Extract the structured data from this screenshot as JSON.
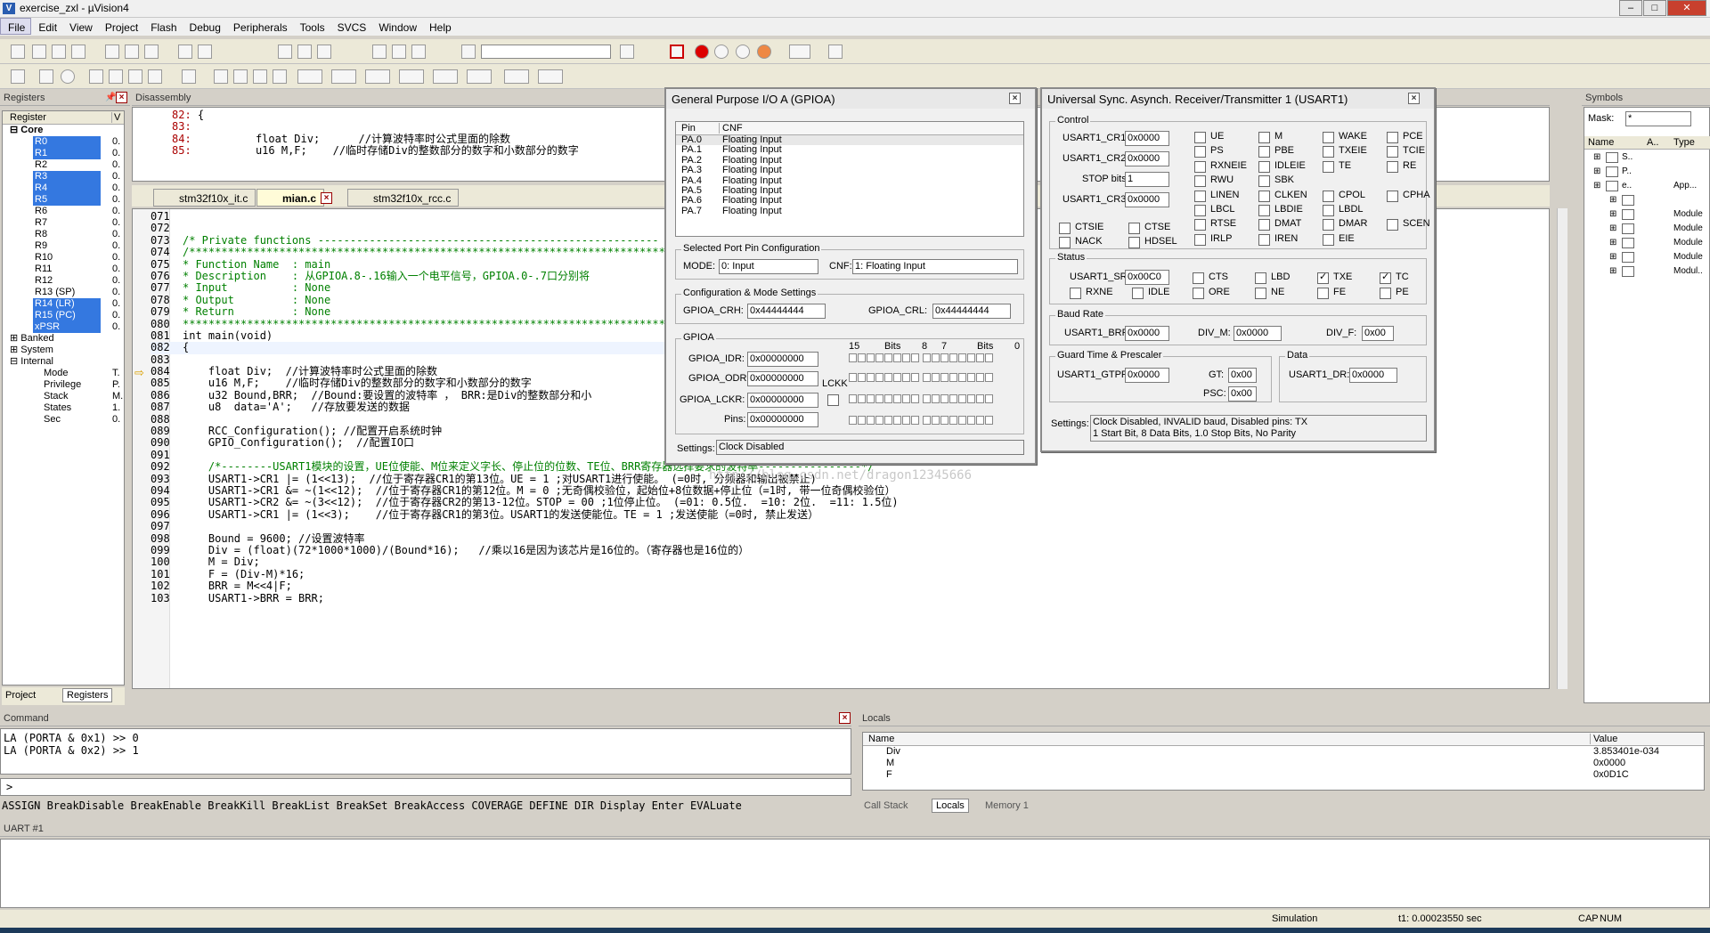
{
  "window": {
    "title": "exercise_zxl - µVision4"
  },
  "menu": [
    "File",
    "Edit",
    "View",
    "Project",
    "Flash",
    "Debug",
    "Peripherals",
    "Tools",
    "SVCS",
    "Window",
    "Help"
  ],
  "registers": {
    "title": "Registers",
    "col_register": "Register",
    "col_value": "V",
    "groups": [
      "Core",
      "Banked",
      "System",
      "Internal"
    ],
    "core": [
      {
        "n": "R0",
        "v": "0.",
        "s": true
      },
      {
        "n": "R1",
        "v": "0.",
        "s": true
      },
      {
        "n": "R2",
        "v": "0.",
        "s": false
      },
      {
        "n": "R3",
        "v": "0.",
        "s": true
      },
      {
        "n": "R4",
        "v": "0.",
        "s": true
      },
      {
        "n": "R5",
        "v": "0.",
        "s": true
      },
      {
        "n": "R6",
        "v": "0.",
        "s": false
      },
      {
        "n": "R7",
        "v": "0.",
        "s": false
      },
      {
        "n": "R8",
        "v": "0.",
        "s": false
      },
      {
        "n": "R9",
        "v": "0.",
        "s": false
      },
      {
        "n": "R10",
        "v": "0.",
        "s": false
      },
      {
        "n": "R11",
        "v": "0.",
        "s": false
      },
      {
        "n": "R12",
        "v": "0.",
        "s": false
      },
      {
        "n": "R13 (SP)",
        "v": "0.",
        "s": false
      },
      {
        "n": "R14 (LR)",
        "v": "0.",
        "s": true
      },
      {
        "n": "R15 (PC)",
        "v": "0.",
        "s": true
      },
      {
        "n": "xPSR",
        "v": "0.",
        "s": true
      }
    ],
    "internal": [
      {
        "n": "Mode",
        "v": "T."
      },
      {
        "n": "Privilege",
        "v": "P."
      },
      {
        "n": "Stack",
        "v": "M."
      },
      {
        "n": "States",
        "v": "1."
      },
      {
        "n": "Sec",
        "v": "0."
      }
    ],
    "tabs": [
      "Project",
      "Registers"
    ]
  },
  "disassembly": {
    "title": "Disassembly",
    "lines": [
      {
        "ln": "82:",
        "t": "{"
      },
      {
        "ln": "83:",
        "t": ""
      },
      {
        "ln": "84:",
        "t": "         float Div;      //计算波特率时公式里面的除数"
      },
      {
        "ln": "85:",
        "t": "         u16 M,F;    //临时存储Div的整数部分的数字和小数部分的数字"
      }
    ]
  },
  "editor": {
    "tabs": [
      "stm32f10x_it.c",
      "mian.c",
      "stm32f10x_rcc.c"
    ],
    "lines": [
      {
        "ln": "071",
        "t": "",
        "c": ""
      },
      {
        "ln": "072",
        "t": "",
        "c": ""
      },
      {
        "ln": "073",
        "t": "/* Private functions -----------------------------------------------------",
        "c": "cm"
      },
      {
        "ln": "074",
        "t": "/*******************************************************************************",
        "c": "cm"
      },
      {
        "ln": "075",
        "t": "* Function Name  : main",
        "c": "cm"
      },
      {
        "ln": "076",
        "t": "* Description    : 从GPIOA.8-.16输入一个电平信号，GPIOA.0-.7口分别将",
        "c": "cm"
      },
      {
        "ln": "077",
        "t": "* Input          : None",
        "c": "cm"
      },
      {
        "ln": "078",
        "t": "* Output         : None",
        "c": "cm"
      },
      {
        "ln": "079",
        "t": "* Return         : None",
        "c": "cm"
      },
      {
        "ln": "080",
        "t": "*******************************************************************************",
        "c": "cm"
      },
      {
        "ln": "081",
        "t": "int main(void)",
        "c": ""
      },
      {
        "ln": "082",
        "t": "{",
        "c": ""
      },
      {
        "ln": "083",
        "t": "",
        "c": ""
      },
      {
        "ln": "084",
        "t": "    float Div;  //计算波特率时公式里面的除数",
        "c": ""
      },
      {
        "ln": "085",
        "t": "    u16 M,F;    //临时存储Div的整数部分的数字和小数部分的数字",
        "c": ""
      },
      {
        "ln": "086",
        "t": "    u32 Bound,BRR;  //Bound:要设置的波特率 ， BRR:是Div的整数部分和小",
        "c": ""
      },
      {
        "ln": "087",
        "t": "    u8  data='A';   //存放要发送的数据",
        "c": ""
      },
      {
        "ln": "088",
        "t": "",
        "c": ""
      },
      {
        "ln": "089",
        "t": "    RCC_Configuration(); //配置开启系统时钟",
        "c": ""
      },
      {
        "ln": "090",
        "t": "    GPIO_Configuration();  //配置IO口",
        "c": ""
      },
      {
        "ln": "091",
        "t": "",
        "c": ""
      },
      {
        "ln": "092",
        "t": "    /*--------USART1模块的设置，UE位使能、M位来定义字长、停止位的位数、TE位、BRR寄存器选择要求的波特率----------------*/",
        "c": "cm"
      },
      {
        "ln": "093",
        "t": "    USART1->CR1 |= (1<<13);  //位于寄存器CR1的第13位。UE = 1 ;对USART1进行使能。 (=0时, 分频器和输出被禁止)",
        "c": ""
      },
      {
        "ln": "094",
        "t": "    USART1->CR1 &= ~(1<<12);  //位于寄存器CR1的第12位。M = 0 ;无奇偶校验位，起始位+8位数据+停止位（=1时, 带一位奇偶校验位）",
        "c": ""
      },
      {
        "ln": "095",
        "t": "    USART1->CR2 &= ~(3<<12);  //位于寄存器CR2的第13-12位。STOP = 00 ;1位停止位。 (=01: 0.5位.  =10: 2位.  =11: 1.5位)",
        "c": ""
      },
      {
        "ln": "096",
        "t": "    USART1->CR1 |= (1<<3);    //位于寄存器CR1的第3位。USART1的发送使能位。TE = 1 ;发送使能（=0时, 禁止发送）",
        "c": ""
      },
      {
        "ln": "097",
        "t": "",
        "c": ""
      },
      {
        "ln": "098",
        "t": "    Bound = 9600; //设置波特率",
        "c": ""
      },
      {
        "ln": "099",
        "t": "    Div = (float)(72*1000*1000)/(Bound*16);   //乘以16是因为该芯片是16位的。（寄存器也是16位的）",
        "c": ""
      },
      {
        "ln": "100",
        "t": "    M = Div;",
        "c": ""
      },
      {
        "ln": "101",
        "t": "    F = (Div-M)*16;",
        "c": ""
      },
      {
        "ln": "102",
        "t": "    BRR = M<<4|F;",
        "c": ""
      },
      {
        "ln": "103",
        "t": "    USART1->BRR = BRR;",
        "c": ""
      }
    ]
  },
  "gpio": {
    "title": "General Purpose I/O A (GPIOA)",
    "col_pin": "Pin",
    "col_cnf": "CNF",
    "pins": [
      {
        "p": "PA.0",
        "c": "Floating Input"
      },
      {
        "p": "PA.1",
        "c": "Floating Input"
      },
      {
        "p": "PA.2",
        "c": "Floating Input"
      },
      {
        "p": "PA.3",
        "c": "Floating Input"
      },
      {
        "p": "PA.4",
        "c": "Floating Input"
      },
      {
        "p": "PA.5",
        "c": "Floating Input"
      },
      {
        "p": "PA.6",
        "c": "Floating Input"
      },
      {
        "p": "PA.7",
        "c": "Floating Input"
      }
    ],
    "sel_legend": "Selected Port Pin Configuration",
    "mode_label": "MODE:",
    "mode_value": "0: Input",
    "cnf_label": "CNF:",
    "cnf_value": "1: Floating Input",
    "cfg_legend": "Configuration & Mode Settings",
    "crh_label": "GPIOA_CRH:",
    "crh": "0x44444444",
    "crl_label": "GPIOA_CRL:",
    "crl": "0x44444444",
    "gpio_legend": "GPIOA",
    "b15": "15",
    "bits1": "Bits",
    "b8": "8",
    "b7": "7",
    "bits2": "Bits",
    "b0": "0",
    "idr_label": "GPIOA_IDR:",
    "idr": "0x00000000",
    "odr_label": "GPIOA_ODR:",
    "odr": "0x00000000",
    "lckr_label": "GPIOA_LCKR:",
    "lckr": "0x00000000",
    "lckk": "LCKK",
    "pins_label": "Pins:",
    "pinsv": "0x00000000",
    "settings_label": "Settings:",
    "settings": "Clock Disabled"
  },
  "usart": {
    "title": "Universal Sync. Asynch. Receiver/Transmitter 1 (USART1)",
    "control": "Control",
    "cr1_label": "USART1_CR1:",
    "cr1": "0x0000",
    "cr2_label": "USART1_CR2:",
    "cr2": "0x0000",
    "stop_label": "STOP bits:",
    "stop": "1",
    "cr3_label": "USART1_CR3:",
    "cr3": "0x0000",
    "ctrl_bits": [
      [
        "UE",
        "M",
        "WAKE",
        "PCE"
      ],
      [
        "PS",
        "PBE",
        "TXEIE",
        "TCIE"
      ],
      [
        "RXNEIE",
        "IDLEIE",
        "TE",
        "RE"
      ],
      [
        "RWU",
        "SBK",
        "",
        ""
      ],
      [
        "LINEN",
        "CLKEN",
        "CPOL",
        "CPHA"
      ],
      [
        "LBCL",
        "LBDIE",
        "LBDL",
        ""
      ],
      [
        "RTSE",
        "DMAT",
        "DMAR",
        "SCEN"
      ],
      [
        "IRLP",
        "IREN",
        "EIE",
        ""
      ]
    ],
    "cr3_bits": [
      "CTSIE",
      "CTSE",
      "NACK",
      "HDSEL"
    ],
    "status": "Status",
    "sr_label": "USART1_SR:",
    "sr": "0x00C0",
    "sr_bits": [
      "CTS",
      "LBD",
      "TXE",
      "TC",
      "RXNE",
      "IDLE",
      "ORE",
      "NE",
      "FE",
      "PE"
    ],
    "baud": "Baud Rate",
    "brr_label": "USART1_BRR:",
    "brr": "0x0000",
    "divm_label": "DIV_M:",
    "divm": "0x0000",
    "divf_label": "DIV_F:",
    "divf": "0x00",
    "guard": "Guard Time & Prescaler",
    "gtpr_label": "USART1_GTPR:",
    "gtpr": "0x0000",
    "gt_label": "GT:",
    "gt": "0x00",
    "psc_label": "PSC:",
    "psc": "0x00",
    "data": "Data",
    "dr_label": "USART1_DR:",
    "dr": "0x0000",
    "settings_label": "Settings:",
    "settings1": "Clock Disabled, INVALID baud, Disabled pins: TX",
    "settings2": "1 Start Bit, 8 Data Bits, 1.0 Stop Bits, No Parity"
  },
  "symbols": {
    "title": "Symbols",
    "mask_label": "Mask:",
    "mask": "*",
    "cols": [
      "Name",
      "A..",
      "Type"
    ],
    "rows": [
      {
        "n": "S..",
        "t": ""
      },
      {
        "n": "P..",
        "t": ""
      },
      {
        "n": "e..",
        "t": "App..."
      },
      {
        "n": "",
        "t": ""
      },
      {
        "n": "",
        "t": "Module"
      },
      {
        "n": "",
        "t": "Module"
      },
      {
        "n": "",
        "t": "Module"
      },
      {
        "n": "",
        "t": "Module"
      },
      {
        "n": "",
        "t": "Modul.."
      }
    ]
  },
  "command": {
    "title": "Command",
    "lines": [
      "LA (PORTA & 0x1) >> 0",
      "LA (PORTA & 0x2) >> 1"
    ],
    "prompt": ">",
    "hint": "ASSIGN BreakDisable BreakEnable BreakKill BreakList BreakSet BreakAccess COVERAGE DEFINE DIR Display Enter EVALuate"
  },
  "locals": {
    "title": "Locals",
    "col_name": "Name",
    "col_value": "Value",
    "rows": [
      {
        "n": "Div",
        "v": "3.853401e-034"
      },
      {
        "n": "M",
        "v": "0x0000"
      },
      {
        "n": "F",
        "v": "0x0D1C"
      }
    ],
    "tabs": [
      "Call Stack",
      "Locals",
      "Memory 1"
    ]
  },
  "uart": {
    "title": "UART #1"
  },
  "statusbar": {
    "mode": "Simulation",
    "time": "t1: 0.00023550 sec",
    "cap": "CAP",
    "num": "NUM"
  },
  "watermark": "http://blog.csdn.net/dragon12345666"
}
